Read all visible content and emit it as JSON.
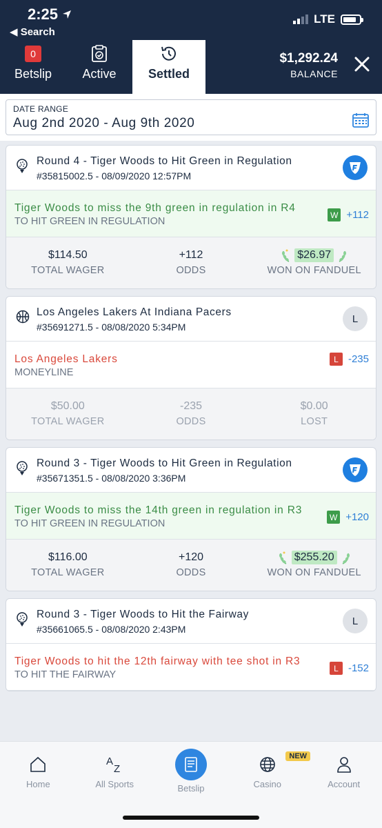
{
  "status_bar": {
    "time": "2:25",
    "back_label": "Search",
    "network": "LTE"
  },
  "header": {
    "tabs": [
      {
        "label": "Betslip",
        "badge": "0"
      },
      {
        "label": "Active"
      },
      {
        "label": "Settled"
      }
    ],
    "balance_amount": "$1,292.24",
    "balance_label": "BALANCE"
  },
  "date_range": {
    "label": "DATE RANGE",
    "value": "Aug 2nd 2020 - Aug 9th 2020"
  },
  "bets": [
    {
      "title": "Round 4 - Tiger Woods to Hit Green in Regulation",
      "meta": "#35815002.5 - 08/09/2020 12:57PM",
      "selection": "Tiger Woods to miss the 9th green in regulation in R4",
      "market": "TO HIT GREEN IN REGULATION",
      "result": "W",
      "odds_display": "+112",
      "wager": "$114.50",
      "wager_label": "TOTAL WAGER",
      "odds": "+112",
      "odds_label": "ODDS",
      "payout": "$26.97",
      "payout_label": "WON ON FANDUEL"
    },
    {
      "title": "Los Angeles Lakers At Indiana Pacers",
      "meta": "#35691271.5 - 08/08/2020 5:34PM",
      "logo_letter": "L",
      "selection": "Los Angeles Lakers",
      "market": "MONEYLINE",
      "result": "L",
      "odds_display": "-235",
      "wager": "$50.00",
      "wager_label": "TOTAL WAGER",
      "odds": "-235",
      "odds_label": "ODDS",
      "payout": "$0.00",
      "payout_label": "LOST"
    },
    {
      "title": "Round 3 - Tiger Woods to Hit Green in Regulation",
      "meta": "#35671351.5 - 08/08/2020 3:36PM",
      "selection": "Tiger Woods to miss the 14th green in regulation in R3",
      "market": "TO HIT GREEN IN REGULATION",
      "result": "W",
      "odds_display": "+120",
      "wager": "$116.00",
      "wager_label": "TOTAL WAGER",
      "odds": "+120",
      "odds_label": "ODDS",
      "payout": "$255.20",
      "payout_label": "WON ON FANDUEL"
    },
    {
      "title": "Round 3 - Tiger Woods to Hit the Fairway",
      "meta": "#35661065.5 - 08/08/2020 2:43PM",
      "logo_letter": "L",
      "selection": "Tiger Woods to hit the 12th fairway with tee shot in R3",
      "market": "TO HIT THE FAIRWAY",
      "result": "L",
      "odds_display": "-152"
    }
  ],
  "bottom_nav": [
    {
      "label": "Home"
    },
    {
      "label": "All Sports"
    },
    {
      "label": "Betslip"
    },
    {
      "label": "Casino",
      "badge": "NEW"
    },
    {
      "label": "Account"
    }
  ],
  "icons": {
    "golf": "golf-ball-icon",
    "basketball": "basketball-icon",
    "fanduel": "fanduel-shield-icon",
    "calendar": "calendar-icon"
  },
  "colors": {
    "navy": "#1a2a44",
    "win": "#3a8c45",
    "loss": "#d9483b",
    "accent": "#2f86e0"
  }
}
